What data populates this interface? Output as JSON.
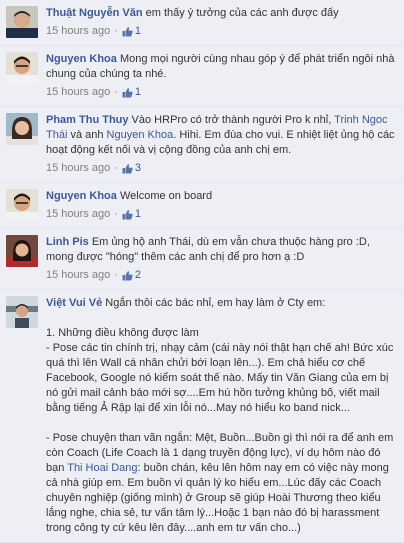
{
  "comments": [
    {
      "author": "Thuật Nguyễn Văn",
      "text": " em thấy ý tưởng của các anh được đấy",
      "time": "15 hours ago",
      "likes": "1"
    },
    {
      "author": "Nguyen Khoa",
      "text": " Mong mọi người cùng nhau góp ý để phát triển ngôi nhà chung của chúng ta nhé.",
      "time": "15 hours ago",
      "likes": "1"
    },
    {
      "author": "Pham Thu Thuy",
      "text_a": " Vào HRPro có trở thành người Pro k nhỉ, ",
      "link_1": "Trinh Ngoc Thái",
      "text_b": " và anh ",
      "link_2": "Nguyen Khoa",
      "text_c": ". Hihi. Em đùa cho vui. E nhiệt liệt ủng hộ các hoạt động kết nối và vị cộng đồng của anh chị em.",
      "time": "15 hours ago",
      "likes": "3"
    },
    {
      "author": "Nguyen Khoa",
      "text": " Welcome on board",
      "time": "15 hours ago",
      "likes": "1"
    },
    {
      "author": "Linh Pis",
      "text": " Em ủng hộ anh Thái, dù em vẫn chưa thuộc hàng pro :D, mong được \"hóng\" thêm các anh chị để pro hơn ạ :D",
      "time": "15 hours ago",
      "likes": "2"
    },
    {
      "author": "Việt Vui Vẻ",
      "intro": " Ngắn thôi các bác nhỉ, em hay làm ở Cty em:",
      "heading": "1. Những điều không được làm",
      "para1": "- Pose các tin chính trị, nhạy cảm (cái này nói thật hạn chế ah! Bức xúc quá thì lên Wall cá nhân chửi bới loạn lên...). Em chả hiểu cơ chế Facebook, Google nó kiểm soát thế nào. Mấy tin Văn Giang của em bị nó gửi mail cảnh báo mới sợ....Em hú hồn tưởng khủng bố, viết mail bằng tiếng Ả Rập lại để xin lỗi nó...May nó hiểu ko band nick...",
      "para2_a": "- Pose chuyện than vãn ngắn: Mệt, Buồn...Buồn gì thì nói ra để anh em còn Coach (Life Coach là 1 dạng truyền động lực), ví dụ hôm nào đó bạn ",
      "para2_link": "Thi Hoai Dang",
      "para2_b": ": buồn chán, kêu lên hôm nay em có việc này mong cả nhà giúp em. Em buồn vì quản lý ko hiểu em...Lúc đấy các Coach chuyên nghiệp (giống mình) ở Group sẽ giúp Hoài Thương theo kiểu lắng nghe, chia sẻ, tư vấn tâm lý...Hoặc 1 bạn nào đó bị harassment trong công ty cứ kêu lên đây....anh em tư vấn cho...)"
    }
  ],
  "colors": {
    "background": "#edeff4",
    "link": "#3b5998",
    "meta": "#808080"
  },
  "icons": {
    "like": "thumbs-up-icon"
  }
}
